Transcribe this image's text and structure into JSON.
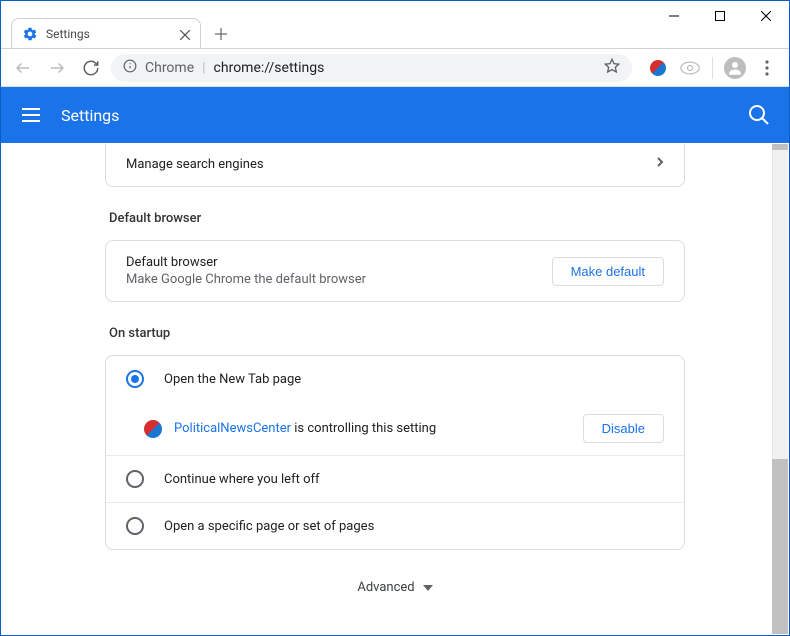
{
  "window": {
    "tab_title": "Settings"
  },
  "omnibox": {
    "scheme_label": "Chrome",
    "url": "chrome://settings"
  },
  "bluebar": {
    "title": "Settings"
  },
  "truncated_row": {
    "label": "Manage search engines"
  },
  "sections": {
    "default_browser": {
      "title": "Default browser",
      "row_title": "Default browser",
      "row_sub": "Make Google Chrome the default browser",
      "button": "Make default"
    },
    "on_startup": {
      "title": "On startup",
      "options": [
        "Open the New Tab page",
        "Continue where you left off",
        "Open a specific page or set of pages"
      ],
      "controlled": {
        "name": "PoliticalNewsCenter",
        "suffix": " is controlling this setting",
        "button": "Disable"
      }
    }
  },
  "advanced_label": "Advanced"
}
